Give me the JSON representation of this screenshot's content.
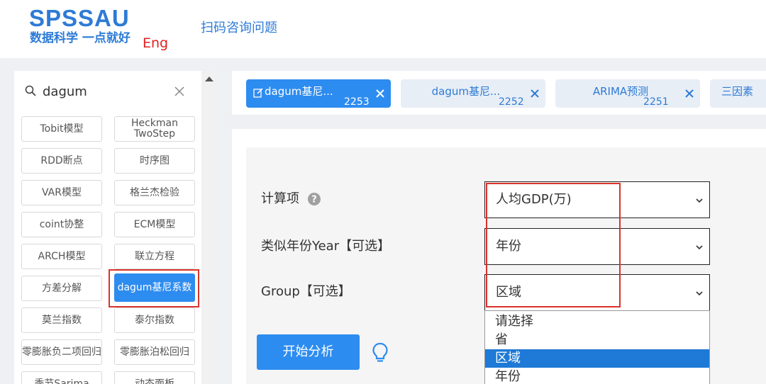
{
  "header": {
    "logo_main": "SPSSAU",
    "logo_sub": "数据科学 一点就好",
    "lang_link": "Eng",
    "scan_link": "扫码咨询问题"
  },
  "sidebar": {
    "search": {
      "value": "dagum",
      "placeholder": ""
    },
    "models": [
      "Tobit模型",
      "Heckman TwoStep",
      "RDD断点",
      "时序图",
      "VAR模型",
      "格兰杰检验",
      "coint协整",
      "ECM模型",
      "ARCH模型",
      "联立方程",
      "方差分解",
      "dagum基尼系数",
      "莫兰指数",
      "泰尔指数",
      "零膨胀负二项回归",
      "零膨胀泊松回归",
      "季节Sarima",
      "动态面板"
    ],
    "active_model": "dagum基尼系数"
  },
  "tabs": [
    {
      "label": "dagum基尼...",
      "id": "2253",
      "active": true
    },
    {
      "label": "dagum基尼...",
      "id": "2252",
      "active": false
    },
    {
      "label": "ARIMA预测",
      "id": "2251",
      "active": false
    },
    {
      "label": "三因素",
      "id": "",
      "active": false
    }
  ],
  "form": {
    "fields": [
      {
        "label": "计算项",
        "value": "人均GDP(万)",
        "has_help": true
      },
      {
        "label": "类似年份Year【可选】",
        "value": "年份",
        "has_help": false
      },
      {
        "label": "Group【可选】",
        "value": "区域",
        "has_help": false
      }
    ],
    "group_dropdown": {
      "options": [
        "请选择",
        "省",
        "区域",
        "年份"
      ],
      "selected": "区域"
    },
    "run_button": "开始分析"
  },
  "colors": {
    "brand_blue": "#2d7bd6",
    "button_blue": "#2d8cf0",
    "highlight_red": "#d9332a",
    "lang_red": "#e02020"
  },
  "icons": [
    "search-icon",
    "close-icon",
    "help-icon",
    "chevron-down-icon",
    "lightbulb-icon",
    "edit-icon",
    "scroll-up-icon"
  ]
}
